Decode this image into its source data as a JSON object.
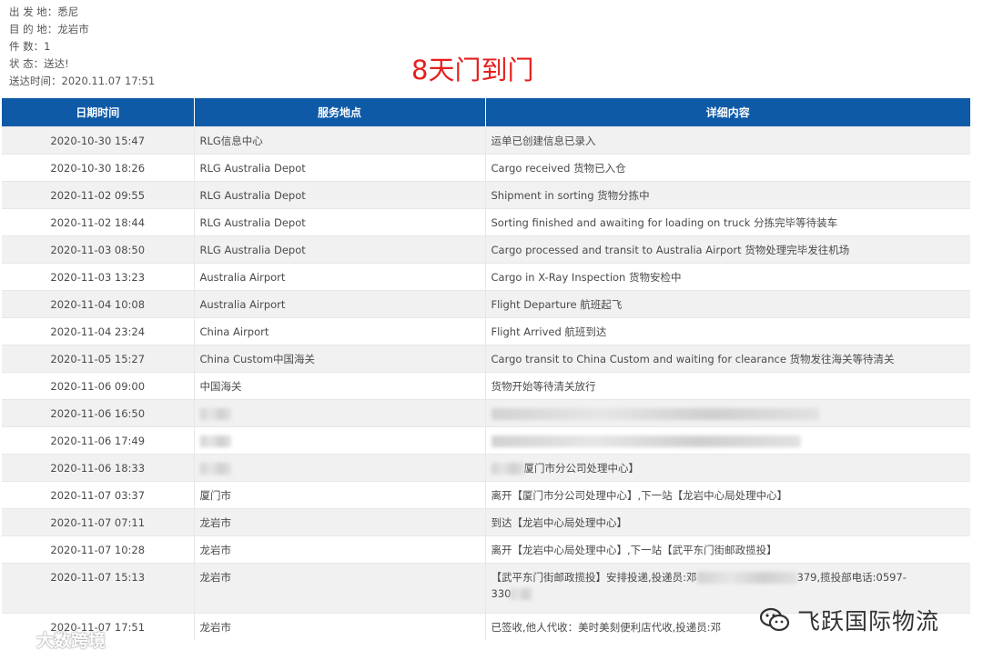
{
  "info": {
    "origin": "出 发 地：悉尼",
    "destination": "目 的 地：龙岩市",
    "pieces": "件 数：1",
    "status": "状 态：送达!",
    "delivered_time": "送达时间：2020.11.07 17:51"
  },
  "headline": "8天门到门",
  "table": {
    "headers": [
      "日期时间",
      "服务地点",
      "详细内容"
    ],
    "rows": [
      {
        "time": "2020-10-30 15:47",
        "place": "RLG信息中心",
        "detail": "运单已创建信息已录入"
      },
      {
        "time": "2020-10-30 18:26",
        "place": "RLG Australia Depot",
        "detail": "Cargo received 货物已入仓"
      },
      {
        "time": "2020-11-02 09:55",
        "place": "RLG Australia Depot",
        "detail": "Shipment in sorting 货物分拣中"
      },
      {
        "time": "2020-11-02 18:44",
        "place": "RLG Australia Depot",
        "detail": "Sorting finished and awaiting for loading on truck 分拣完毕等待装车"
      },
      {
        "time": "2020-11-03 08:50",
        "place": "RLG Australia Depot",
        "detail": "Cargo processed and transit to Australia Airport 货物处理完毕发往机场"
      },
      {
        "time": "2020-11-03 13:23",
        "place": "Australia Airport",
        "detail": "Cargo in X-Ray Inspection 货物安检中"
      },
      {
        "time": "2020-11-04 10:08",
        "place": "Australia Airport",
        "detail": "Flight Departure 航班起飞"
      },
      {
        "time": "2020-11-04 23:24",
        "place": "China Airport",
        "detail": "Flight Arrived 航班到达"
      },
      {
        "time": "2020-11-05 15:27",
        "place": "China Custom中国海关",
        "detail": "Cargo transit to China Custom and waiting for clearance 货物发往海关等待清关"
      },
      {
        "time": "2020-11-06 09:00",
        "place": "中国海关",
        "detail": "货物开始等待清关放行"
      },
      {
        "time": "2020-11-06 16:50",
        "place": "",
        "detail": ""
      },
      {
        "time": "2020-11-06 17:49",
        "place": "",
        "detail": ""
      },
      {
        "time": "2020-11-06 18:33",
        "place": "",
        "detail": "厦门市分公司处理中心】"
      },
      {
        "time": "2020-11-07 03:37",
        "place": "厦门市",
        "detail": "离开【厦门市分公司处理中心】,下一站【龙岩中心局处理中心】"
      },
      {
        "time": "2020-11-07 07:11",
        "place": "龙岩市",
        "detail": "到达【龙岩中心局处理中心】"
      },
      {
        "time": "2020-11-07 10:28",
        "place": "龙岩市",
        "detail": "离开【龙岩中心局处理中心】,下一站【武平东门街邮政揽投】"
      },
      {
        "time": "2020-11-07 15:13",
        "place": "龙岩市",
        "detail_a": "【武平东门街邮政揽投】安排投递,投递员:邓",
        "detail_b": "379,揽投部电话:0597-",
        "detail_c": "330"
      },
      {
        "time": "2020-11-07 17:51",
        "place": "龙岩市",
        "detail": "已签收,他人代收：美时美刻便利店代收,投递员:邓"
      }
    ]
  },
  "watermark_left": "大数跨境",
  "watermark_right": "飞跃国际物流"
}
